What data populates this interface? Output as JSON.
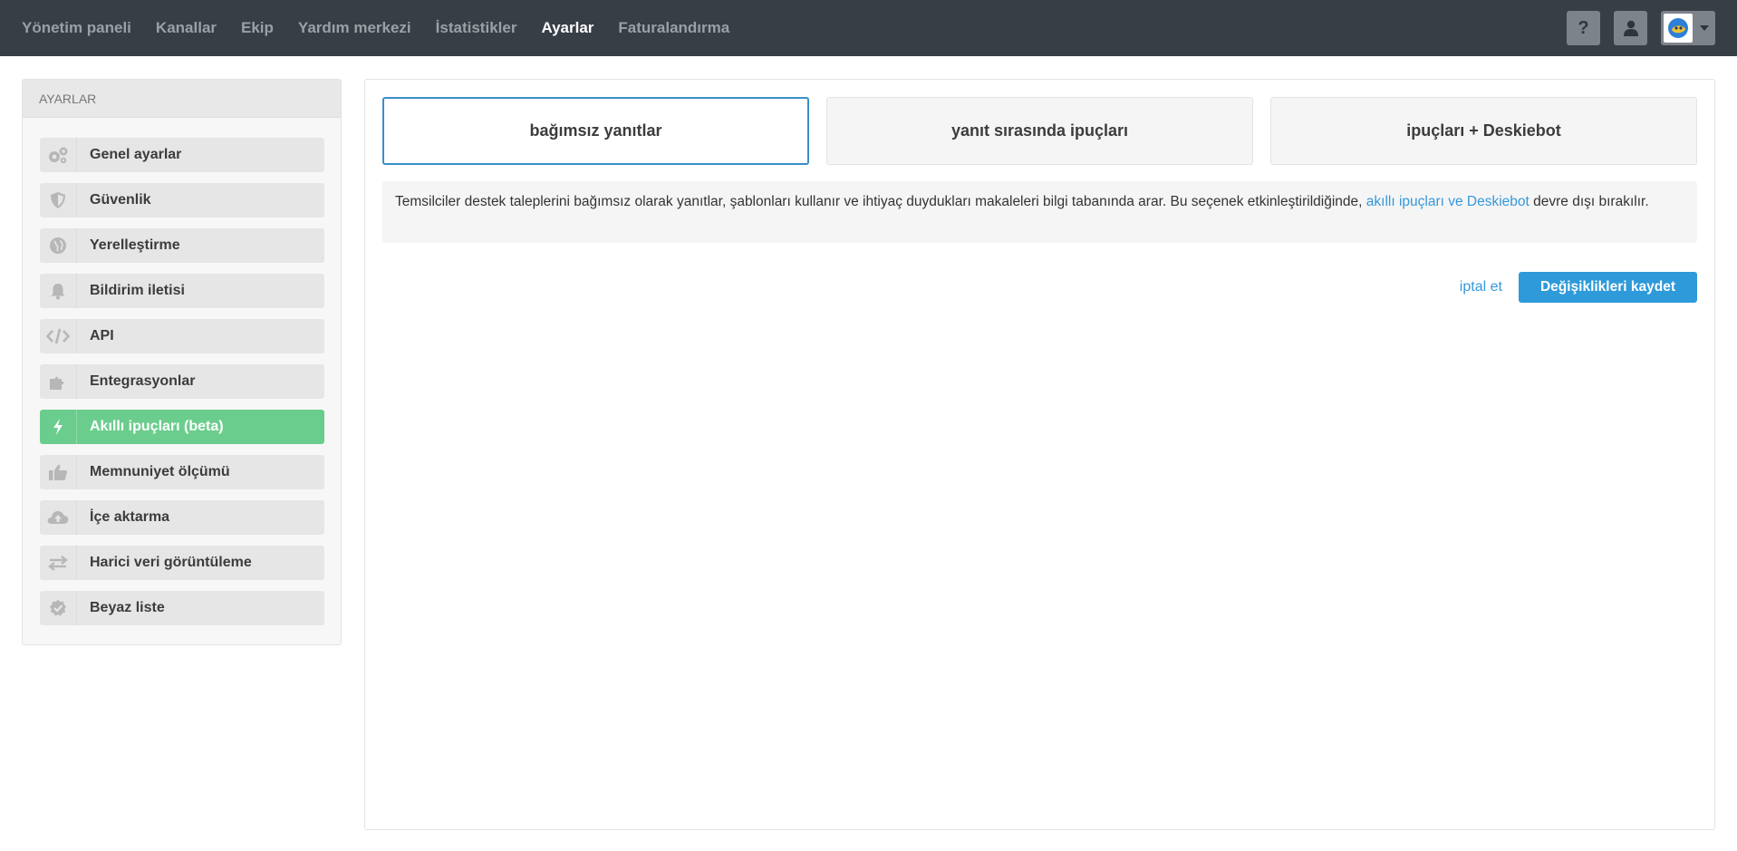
{
  "topnav": {
    "items": [
      {
        "label": "Yönetim paneli"
      },
      {
        "label": "Kanallar"
      },
      {
        "label": "Ekip"
      },
      {
        "label": "Yardım merkezi"
      },
      {
        "label": "İstatistikler"
      },
      {
        "label": "Ayarlar",
        "active": true
      },
      {
        "label": "Faturalandırma"
      }
    ],
    "help_label": "?"
  },
  "sidebar": {
    "header": "AYARLAR",
    "items": [
      {
        "label": "Genel ayarlar",
        "icon": "gears-icon"
      },
      {
        "label": "Güvenlik",
        "icon": "shield-icon"
      },
      {
        "label": "Yerelleştirme",
        "icon": "globe-icon"
      },
      {
        "label": "Bildirim iletisi",
        "icon": "bell-icon"
      },
      {
        "label": "API",
        "icon": "code-icon"
      },
      {
        "label": "Entegrasyonlar",
        "icon": "puzzle-icon"
      },
      {
        "label": "Akıllı ipuçları (beta)",
        "icon": "lightning-icon",
        "active": true
      },
      {
        "label": "Memnuniyet ölçümü",
        "icon": "thumbs-up-icon"
      },
      {
        "label": "İçe aktarma",
        "icon": "cloud-upload-icon"
      },
      {
        "label": "Harici veri görüntüleme",
        "icon": "exchange-icon"
      },
      {
        "label": "Beyaz liste",
        "icon": "check-badge-icon"
      }
    ]
  },
  "main": {
    "options": [
      {
        "label": "bağımsız yanıtlar",
        "selected": true
      },
      {
        "label": "yanıt sırasında ipuçları"
      },
      {
        "label": "ipuçları + Deskiebot"
      }
    ],
    "info": {
      "text_before": "Temsilciler destek taleplerini bağımsız olarak yanıtlar, şablonları kullanır ve ihtiyaç duydukları makaleleri bilgi tabanında arar. Bu seçenek etkinleştirildiğinde, ",
      "link": "akıllı ipuçları ve Deskiebot",
      "text_after": " devre dışı bırakılır."
    },
    "cancel_label": "iptal et",
    "save_label": "Değişiklikleri kaydet"
  },
  "colors": {
    "topbar": "#373e45",
    "accent_blue": "#2e9ad9",
    "active_green": "#6bcd8d"
  }
}
